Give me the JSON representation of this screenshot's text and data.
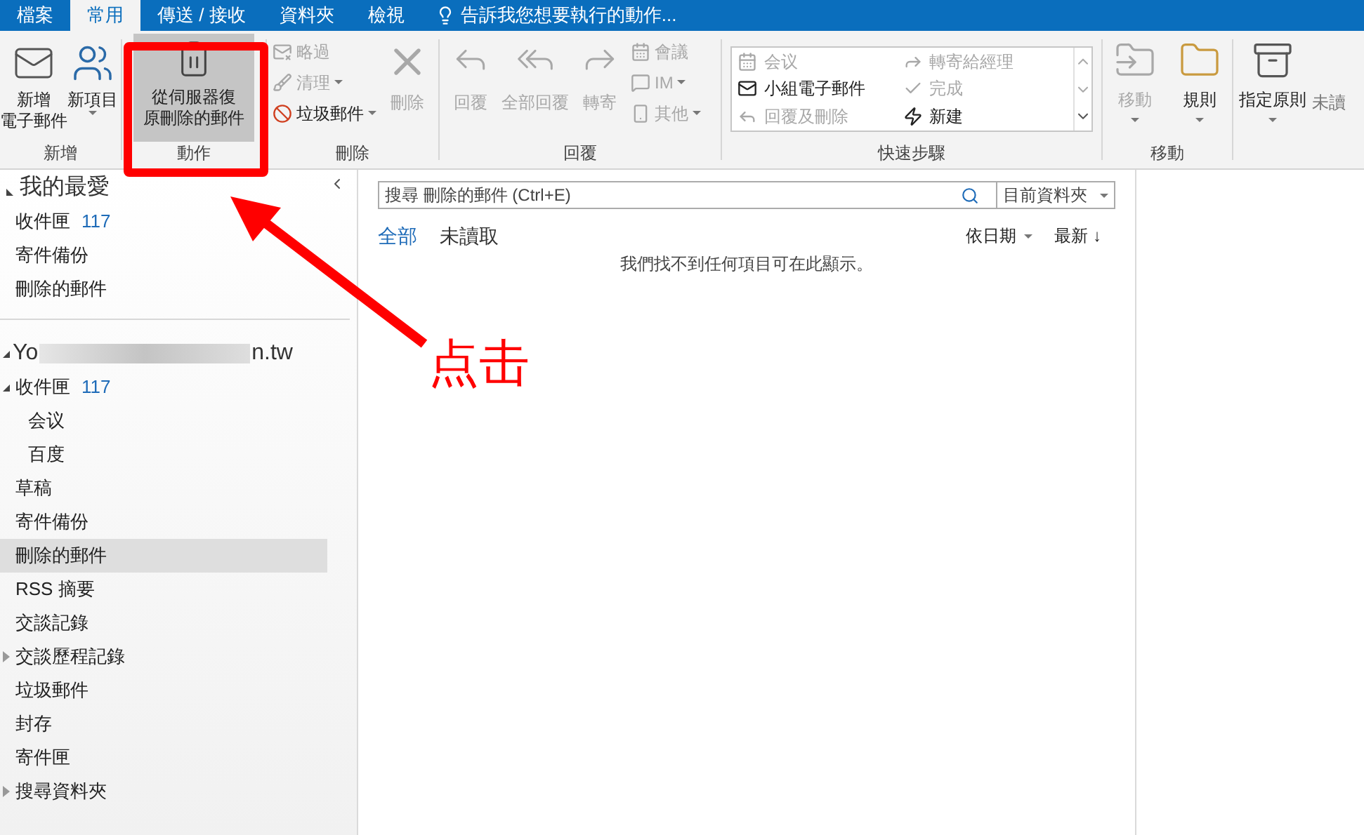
{
  "tabs": [
    {
      "label": "檔案",
      "selected": false
    },
    {
      "label": "常用",
      "selected": true
    },
    {
      "label": "傳送 / 接收",
      "selected": false
    },
    {
      "label": "資料夾",
      "selected": false
    },
    {
      "label": "檢視",
      "selected": false
    }
  ],
  "tell_me": "告訴我您想要執行的動作...",
  "ribbon": {
    "new_group": {
      "label": "新增",
      "buttons": [
        {
          "lines": [
            "新增",
            "電子郵件"
          ],
          "kind": "mail",
          "dropdown": false
        },
        {
          "lines": [
            "新項目"
          ],
          "kind": "items",
          "dropdown": true
        }
      ]
    },
    "action_group": {
      "label": "動作",
      "button": {
        "lines": [
          "從伺服器復",
          "原刪除的郵件"
        ],
        "selected": true
      }
    },
    "delete_group": {
      "label": "刪除",
      "small": [
        {
          "label": "略過",
          "kind": "ignore",
          "disabled": true,
          "dropdown": false
        },
        {
          "label": "清理",
          "kind": "clean",
          "disabled": true,
          "dropdown": true
        },
        {
          "label": "垃圾郵件",
          "kind": "junk",
          "disabled": false,
          "dropdown": true
        }
      ],
      "big": {
        "label": "刪除",
        "disabled": true
      }
    },
    "respond_group": {
      "label": "回覆",
      "big": [
        {
          "label": "回覆",
          "kind": "reply",
          "disabled": true
        },
        {
          "label": "全部回覆",
          "kind": "replyall",
          "disabled": true
        },
        {
          "label": "轉寄",
          "kind": "forward",
          "disabled": true
        }
      ],
      "small": [
        {
          "label": "會議",
          "kind": "meeting",
          "disabled": true,
          "dropdown": false
        },
        {
          "label": "IM",
          "kind": "im",
          "disabled": true,
          "dropdown": true
        },
        {
          "label": "其他",
          "kind": "more",
          "disabled": true,
          "dropdown": true
        }
      ]
    },
    "quick_steps": {
      "label": "快速步驟",
      "items": [
        {
          "label": "会议",
          "kind": "meeting",
          "disabled": true
        },
        {
          "label": "轉寄給經理",
          "kind": "forward",
          "disabled": true
        },
        {
          "label": "小組電子郵件",
          "kind": "mail",
          "disabled": false
        },
        {
          "label": "完成",
          "kind": "done",
          "disabled": true
        },
        {
          "label": "回覆及刪除",
          "kind": "reply",
          "disabled": true
        },
        {
          "label": "新建",
          "kind": "new",
          "disabled": false
        }
      ]
    },
    "move_group": {
      "label": "移動",
      "buttons": [
        {
          "label": "移動",
          "kind": "move",
          "disabled": true
        },
        {
          "label": "規則",
          "kind": "rules",
          "disabled": false
        }
      ]
    },
    "policy_button": {
      "label": "指定原則"
    },
    "unread_button": {
      "label": "未讀"
    }
  },
  "sidebar": {
    "favorites": {
      "title": "我的最愛",
      "expanded": true,
      "items": [
        {
          "label": "收件匣",
          "count": "117"
        },
        {
          "label": "寄件備份"
        },
        {
          "label": "刪除的郵件"
        }
      ]
    },
    "account": {
      "prefix": "Yo",
      "suffix": "n.tw",
      "expanded": true,
      "folders": [
        {
          "label": "收件匣",
          "count": "117",
          "expanded": true,
          "selected": false,
          "children": [
            {
              "label": "会议",
              "selected": false
            },
            {
              "label": "百度",
              "selected": false
            }
          ]
        },
        {
          "label": "草稿",
          "selected": false
        },
        {
          "label": "寄件備份",
          "selected": false
        },
        {
          "label": "刪除的郵件",
          "selected": true
        },
        {
          "label": "RSS 摘要",
          "selected": false
        },
        {
          "label": "交談記錄",
          "selected": false
        },
        {
          "label": "交談歷程記錄",
          "expanded": false,
          "selected": false
        },
        {
          "label": "垃圾郵件",
          "selected": false
        },
        {
          "label": "封存",
          "selected": false
        },
        {
          "label": "寄件匣",
          "selected": false
        },
        {
          "label": "搜尋資料夾",
          "expanded": false,
          "selected": false
        }
      ]
    }
  },
  "search": {
    "placeholder": "搜尋 刪除的郵件 (Ctrl+E)",
    "scope": "目前資料夾"
  },
  "filters": [
    {
      "label": "全部",
      "selected": true
    },
    {
      "label": "未讀取",
      "selected": false
    }
  ],
  "sort": {
    "by": "依日期",
    "order": "最新",
    "order_arrow": "↓"
  },
  "empty_message": "我們找不到任何項目可在此顯示。",
  "annotation": {
    "text": "点击"
  }
}
